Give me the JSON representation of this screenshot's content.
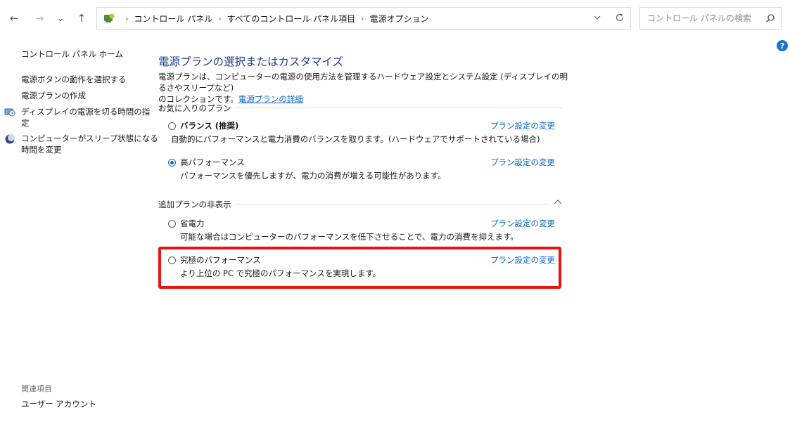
{
  "nav": {
    "back": "←",
    "forward": "→",
    "recent": "⌄",
    "up": "↑"
  },
  "address": {
    "crumbs": [
      "コントロール パネル",
      "すべてのコントロール パネル項目",
      "電源オプション"
    ],
    "separator": "›"
  },
  "search": {
    "placeholder": "コントロール パネルの検索"
  },
  "help_label": "?",
  "sidebar": {
    "home": "コントロール パネル ホーム",
    "links": [
      "電源ボタンの動作を選択する",
      "電源プランの作成"
    ],
    "icon_links": [
      {
        "line1": "ディスプレイの電源を切る時間の指",
        "line2": "定",
        "icon": "display-clock-icon"
      },
      {
        "line1": "コンピューターがスリープ状態になる",
        "line2": "時間を変更",
        "icon": "moon-sleep-icon"
      }
    ],
    "related_title": "関連項目",
    "related_link": "ユーザー アカウント"
  },
  "main": {
    "title": "電源プランの選択またはカスタマイズ",
    "desc_line1": "電源プランは、コンピューターの電源の使用方法を管理するハードウェア設定とシステム設定 (ディスプレイの明るさやスリープなど)",
    "desc_line2": "のコレクションです。",
    "desc_link": "電源プランの詳細",
    "favorites_label": "お気に入りのプラン",
    "hidden_label": "追加プランの非表示",
    "change_link": "プラン設定の変更",
    "plans": [
      {
        "name": "バランス (推奨)",
        "bold": true,
        "desc": "自動的にパフォーマンスと電力消費のバランスを取ります。(ハードウェアでサポートされている場合)",
        "checked": false
      },
      {
        "name": "高パフォーマンス",
        "bold": false,
        "desc": "パフォーマンスを優先しますが、電力の消費が増える可能性があります。",
        "checked": true
      },
      {
        "name": "省電力",
        "bold": false,
        "desc": "可能な場合はコンピューターのパフォーマンスを低下させることで、電力の消費を抑えます。",
        "checked": false
      },
      {
        "name": "究極のパフォーマンス",
        "bold": false,
        "desc": "より上位の PC で究極のパフォーマンスを実現します。",
        "checked": false
      }
    ]
  },
  "colors": {
    "link": "#0a66c2",
    "title": "#1e3f8a",
    "highlight": "#ee1111"
  }
}
